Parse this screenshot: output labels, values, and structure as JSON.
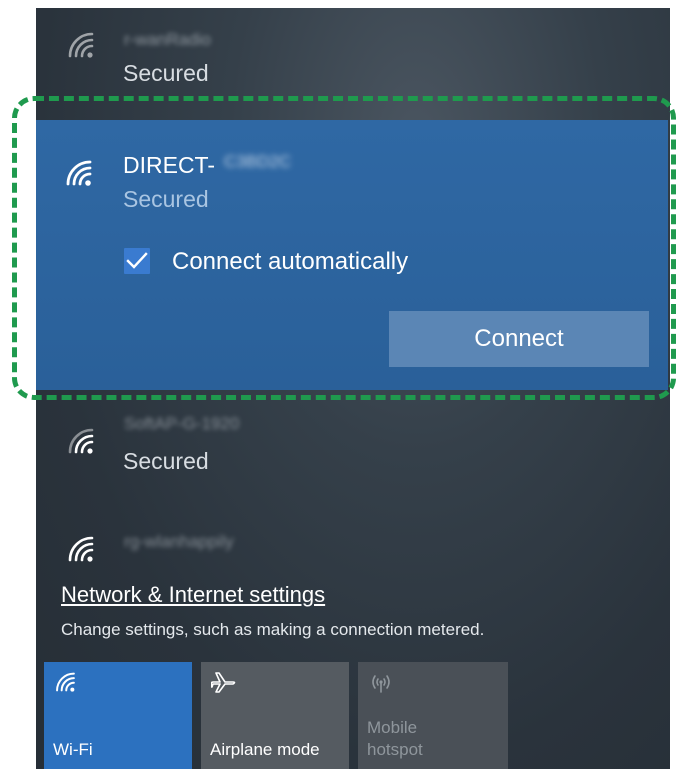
{
  "networks": [
    {
      "name": "r-wanRadio",
      "status": "Secured"
    },
    {
      "name": "DIRECT-",
      "name_suffix": "C3BD2C",
      "status": "Secured",
      "selected": true
    },
    {
      "name": "SoftAP-G-1920",
      "status": "Secured"
    },
    {
      "name": "rg-wlanhappily",
      "status": ""
    }
  ],
  "selected_network": {
    "connect_automatically_label": "Connect automatically",
    "connect_automatically_checked": true,
    "connect_button_label": "Connect"
  },
  "settings": {
    "link_label": "Network & Internet settings",
    "description": "Change settings, such as making a connection metered."
  },
  "quick_actions": [
    {
      "label": "Wi-Fi",
      "icon": "wifi-icon",
      "active": true
    },
    {
      "label": "Airplane mode",
      "icon": "airplane-icon",
      "active": false
    },
    {
      "label": "Mobile hotspot",
      "label_line1": "Mobile",
      "label_line2": "hotspot",
      "icon": "hotspot-icon",
      "active": false,
      "disabled": true
    }
  ],
  "colors": {
    "panel_bg": "#2a333c",
    "selected_bg": "#2f68a4",
    "connect_button": "#5b86b5",
    "checkbox": "#3a7bd0",
    "highlight_frame": "#1f9a4e",
    "wifi_tile_active": "#2c71bf",
    "tile_inactive": "#555b61"
  }
}
